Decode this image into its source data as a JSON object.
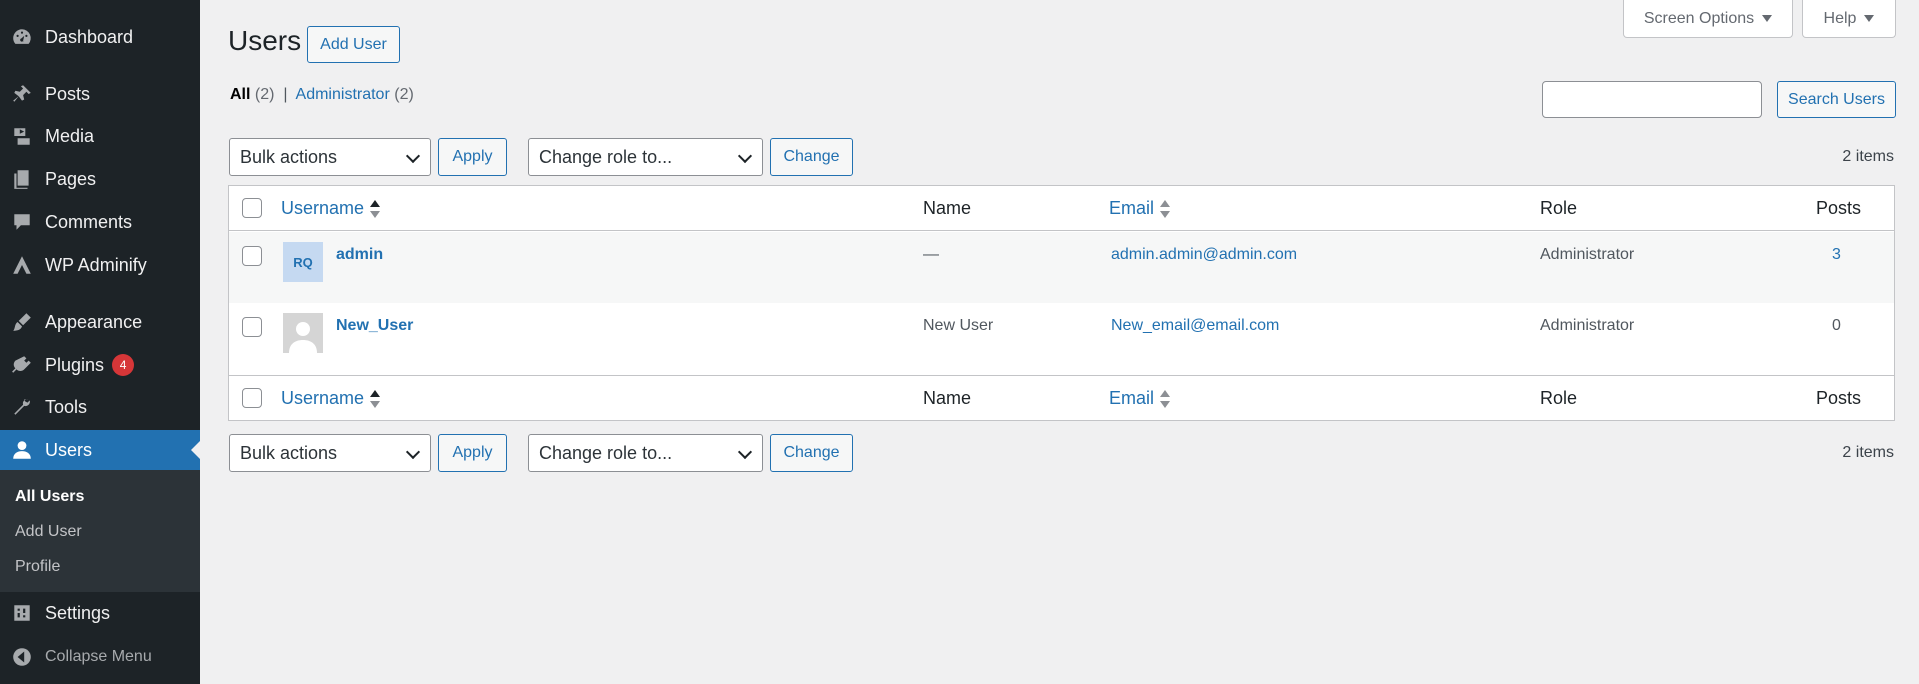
{
  "sidebar": {
    "items": [
      {
        "label": "Dashboard",
        "icon": "dashboard-icon"
      },
      {
        "label": "Posts",
        "icon": "pin-icon"
      },
      {
        "label": "Media",
        "icon": "media-icon"
      },
      {
        "label": "Pages",
        "icon": "pages-icon"
      },
      {
        "label": "Comments",
        "icon": "comment-icon"
      },
      {
        "label": "WP Adminify",
        "icon": "adminify-icon"
      },
      {
        "label": "Appearance",
        "icon": "brush-icon"
      },
      {
        "label": "Plugins",
        "icon": "plugin-icon",
        "badge": "4"
      },
      {
        "label": "Tools",
        "icon": "wrench-icon"
      },
      {
        "label": "Users",
        "icon": "user-icon"
      },
      {
        "label": "Settings",
        "icon": "settings-icon"
      }
    ],
    "submenu": [
      "All Users",
      "Add User",
      "Profile"
    ],
    "collapse_label": "Collapse Menu"
  },
  "top": {
    "screen_options": "Screen Options",
    "help": "Help"
  },
  "page": {
    "title": "Users",
    "add_user": "Add User"
  },
  "filters": {
    "all_label": "All",
    "all_count": "(2)",
    "separator": "|",
    "admin_label": "Administrator",
    "admin_count": "(2)"
  },
  "search": {
    "button": "Search Users",
    "value": ""
  },
  "bulk": {
    "bulk_actions": "Bulk actions",
    "apply": "Apply",
    "change_role": "Change role to...",
    "change": "Change",
    "items": "2 items"
  },
  "table": {
    "columns": {
      "username": "Username",
      "name": "Name",
      "email": "Email",
      "role": "Role",
      "posts": "Posts"
    },
    "rows": [
      {
        "avatar_text": "RQ",
        "username": "admin",
        "name": "—",
        "email": "admin.admin@admin.com",
        "role": "Administrator",
        "posts": "3"
      },
      {
        "avatar_text": "",
        "username": "New_User",
        "name": "New User",
        "email": "New_email@email.com",
        "role": "Administrator",
        "posts": "0"
      }
    ]
  },
  "colors": {
    "sidebar_bg": "#1d2327",
    "accent": "#2271b1",
    "badge": "#d63638",
    "page_bg": "#f0f0f1"
  }
}
